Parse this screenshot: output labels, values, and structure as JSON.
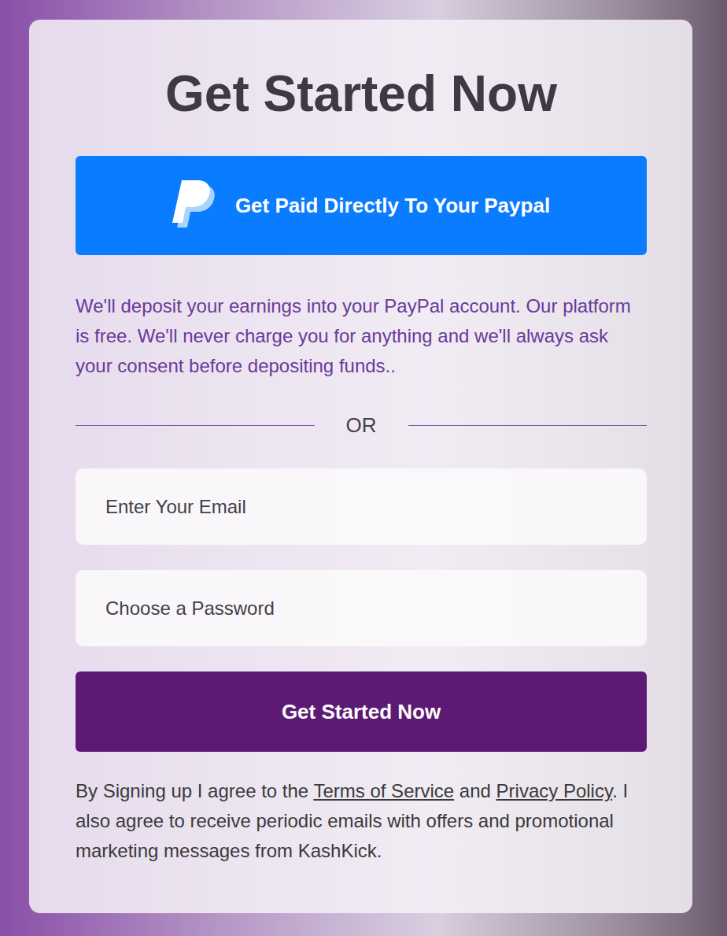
{
  "signup": {
    "title": "Get Started Now",
    "paypal_button": "Get Paid Directly To Your Paypal",
    "description": "We'll deposit your earnings into your PayPal account. Our platform is free. We'll never charge you for anything and we'll always ask your consent before depositing funds..",
    "divider": "OR",
    "email": {
      "placeholder": "Enter Your Email"
    },
    "password": {
      "placeholder": "Choose a Password"
    },
    "submit": "Get Started Now",
    "terms": [
      {
        "kind": "text",
        "text": "By Signing up I agree to the "
      },
      {
        "kind": "link",
        "text": "Terms of Service"
      },
      {
        "kind": "text",
        "text": " and "
      },
      {
        "kind": "link",
        "text": "Privacy Policy"
      },
      {
        "kind": "text",
        "text": ". I also agree to receive periodic emails with offers and promotional marketing messages from KashKick."
      }
    ]
  }
}
